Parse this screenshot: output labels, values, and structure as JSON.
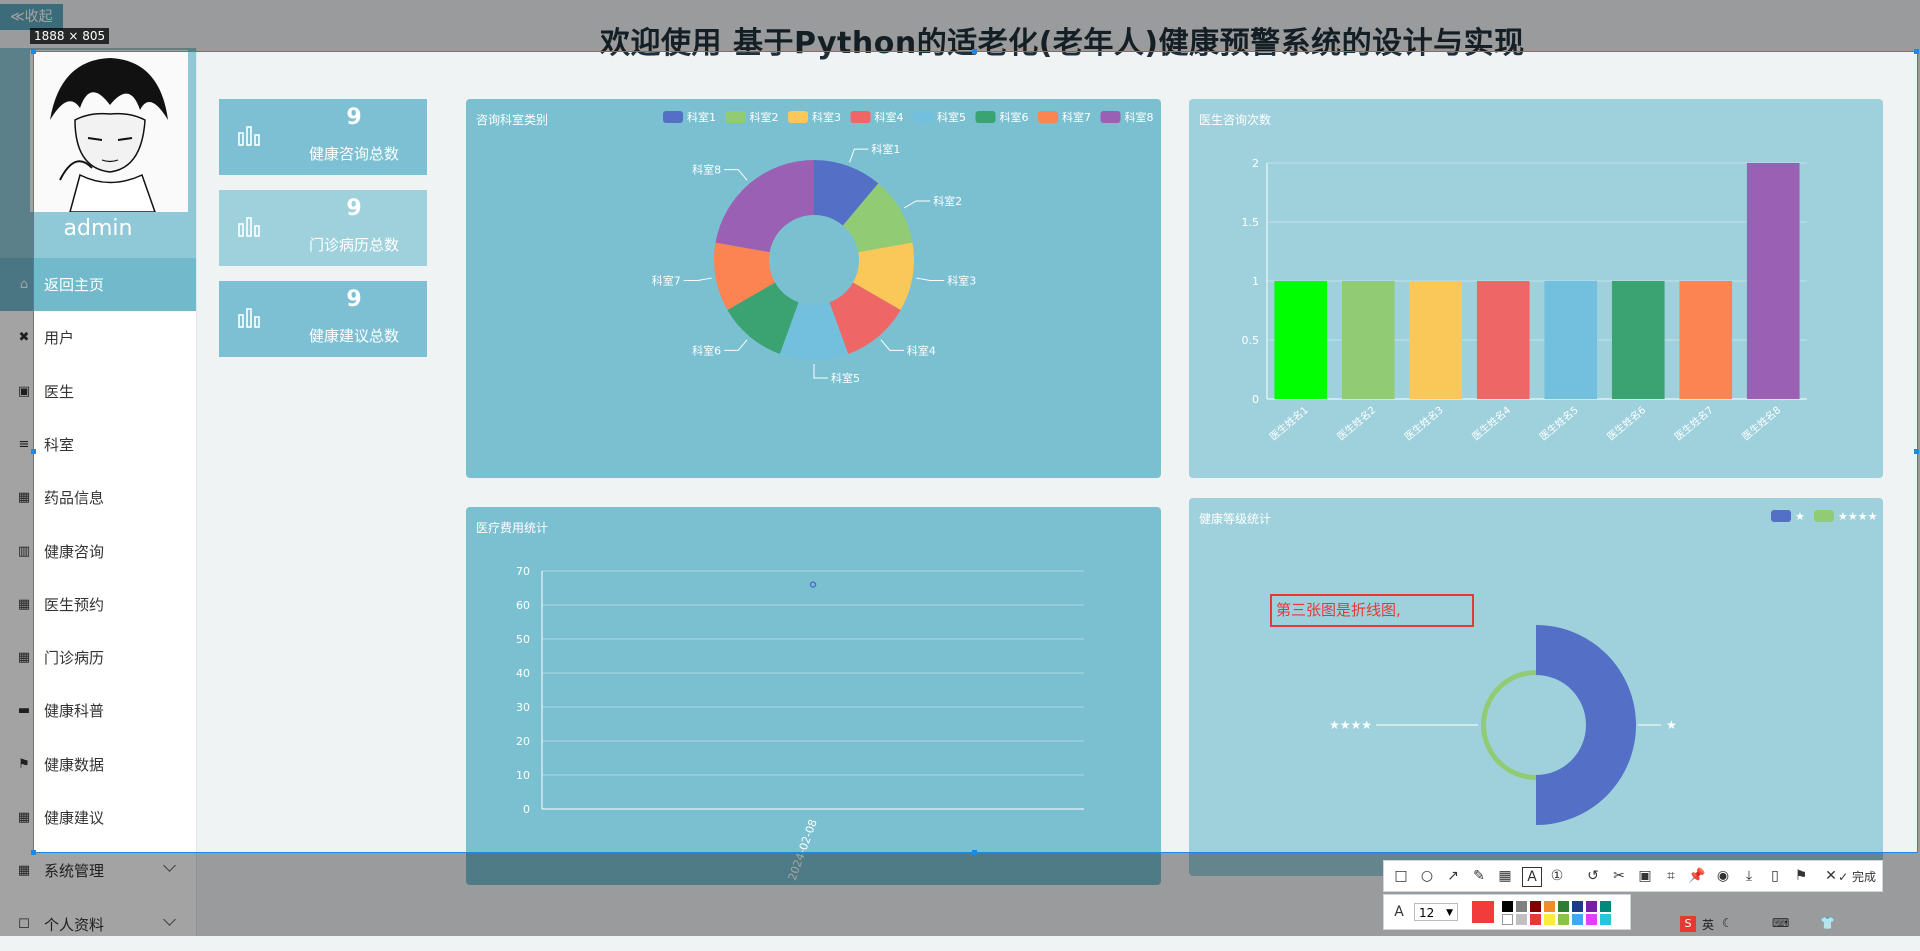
{
  "page": {
    "title": "欢迎使用 基于Python的适老化(老年人)健康预警系统的设计与实现",
    "collapse_label": "≪收起",
    "selection_size": "1888 × 805"
  },
  "sidebar": {
    "username": "admin",
    "items": [
      {
        "label": "返回主页",
        "icon": "home-icon",
        "active": true
      },
      {
        "label": "用户",
        "icon": "users-icon"
      },
      {
        "label": "医生",
        "icon": "clipboard-icon"
      },
      {
        "label": "科室",
        "icon": "list-icon"
      },
      {
        "label": "药品信息",
        "icon": "grid-icon"
      },
      {
        "label": "健康咨询",
        "icon": "bar-chart-icon"
      },
      {
        "label": "医生预约",
        "icon": "grid-icon"
      },
      {
        "label": "门诊病历",
        "icon": "grid-icon"
      },
      {
        "label": "健康科普",
        "icon": "book-icon"
      },
      {
        "label": "健康数据",
        "icon": "flag-icon"
      },
      {
        "label": "健康建议",
        "icon": "grid-icon"
      },
      {
        "label": "系统管理",
        "icon": "grid-icon",
        "expandable": true
      },
      {
        "label": "个人资料",
        "icon": "profile-icon",
        "expandable": true
      }
    ]
  },
  "stats": [
    {
      "value": "9",
      "label": "健康咨询总数"
    },
    {
      "value": "9",
      "label": "门诊病历总数"
    },
    {
      "value": "9",
      "label": "健康建议总数"
    }
  ],
  "panels": {
    "pie": {
      "title": "咨询科室类别"
    },
    "bar": {
      "title": "医生咨询次数"
    },
    "line": {
      "title": "医疗费用统计"
    },
    "rose": {
      "title": "健康等级统计"
    }
  },
  "annotation": {
    "text": "第三张图是折线图,"
  },
  "toolbar": {
    "done_label": "完成",
    "font_size": "12"
  },
  "chart_data": [
    {
      "type": "pie",
      "title": "咨询科室类别",
      "categories": [
        "科室1",
        "科室2",
        "科室3",
        "科室4",
        "科室5",
        "科室6",
        "科室7",
        "科室8"
      ],
      "values": [
        1,
        1,
        1,
        1,
        1,
        1,
        1,
        2
      ],
      "colors": [
        "#5470c6",
        "#91cc75",
        "#fac858",
        "#ee6666",
        "#73c0de",
        "#3ba272",
        "#fc8452",
        "#9a60b4"
      ],
      "legend": "top-right"
    },
    {
      "type": "bar",
      "title": "医生咨询次数",
      "categories": [
        "医生姓名1",
        "医生姓名2",
        "医生姓名3",
        "医生姓名4",
        "医生姓名5",
        "医生姓名6",
        "医生姓名7",
        "医生姓名8"
      ],
      "values": [
        1,
        1,
        1,
        1,
        1,
        1,
        1,
        2
      ],
      "colors": [
        "#00ff00",
        "#91cc75",
        "#fac858",
        "#ee6666",
        "#73c0de",
        "#3ba272",
        "#fc8452",
        "#9a60b4"
      ],
      "yticks": [
        "0",
        "0.5",
        "1",
        "1.5",
        "2"
      ],
      "ylim": [
        0,
        2
      ]
    },
    {
      "type": "line",
      "title": "医疗费用统计",
      "x": [
        "2024-02-08"
      ],
      "y": [
        66
      ],
      "yticks": [
        "0",
        "10",
        "20",
        "30",
        "40",
        "50",
        "60",
        "70"
      ],
      "ylim": [
        0,
        70
      ]
    },
    {
      "type": "pie",
      "title": "健康等级统计",
      "categories": [
        "★",
        "★★★★"
      ],
      "values": [
        8,
        1
      ],
      "colors": [
        "#5470c6",
        "#91cc75"
      ],
      "legend": "top-right"
    }
  ]
}
